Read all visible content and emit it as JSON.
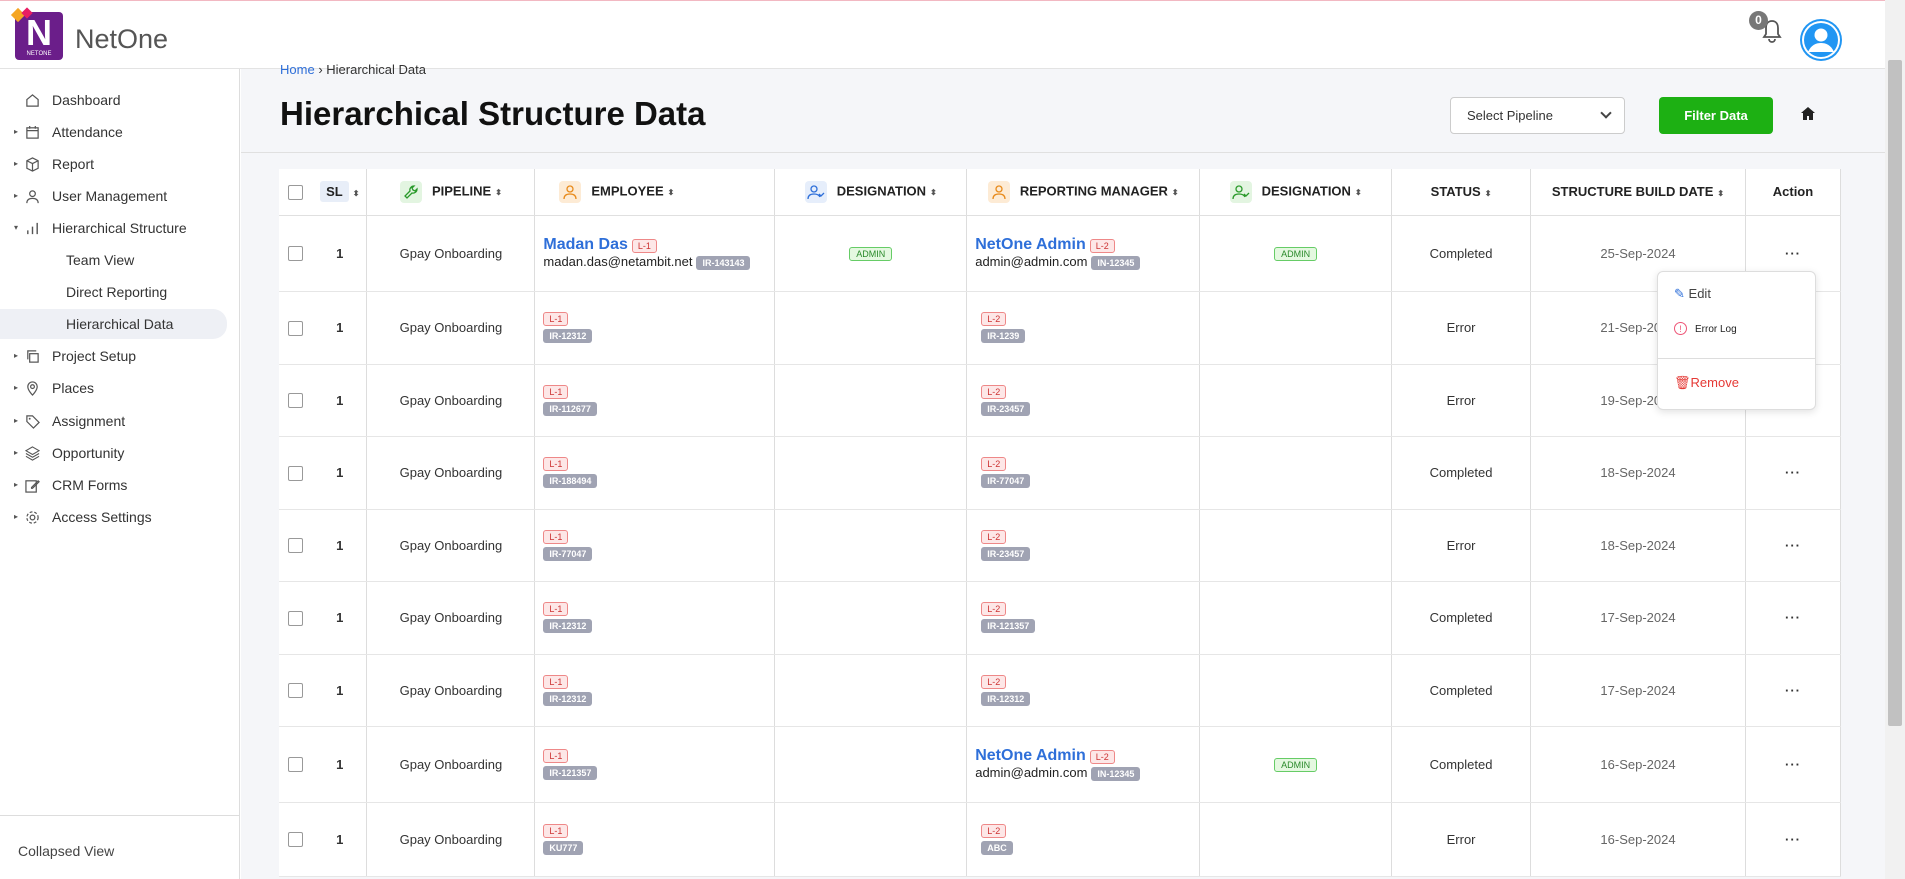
{
  "brand": {
    "name": "NetOne",
    "logo_letter": "N",
    "logo_text": "NETONE"
  },
  "header": {
    "notification_count": "0"
  },
  "sidebar": {
    "items": [
      {
        "label": "Dashboard",
        "icon": "home-icon"
      },
      {
        "label": "Attendance",
        "icon": "calendar-icon"
      },
      {
        "label": "Report",
        "icon": "box-icon"
      },
      {
        "label": "User Management",
        "icon": "user-icon"
      },
      {
        "label": "Hierarchical Structure",
        "icon": "bar-chart-icon"
      },
      {
        "label": "Team View"
      },
      {
        "label": "Direct Reporting"
      },
      {
        "label": "Hierarchical Data"
      },
      {
        "label": "Project Setup",
        "icon": "copy-icon"
      },
      {
        "label": "Places",
        "icon": "map-pin-icon"
      },
      {
        "label": "Assignment",
        "icon": "tag-icon"
      },
      {
        "label": "Opportunity",
        "icon": "layers-icon"
      },
      {
        "label": "CRM Forms",
        "icon": "edit-icon"
      },
      {
        "label": "Access Settings",
        "icon": "gear-icon"
      }
    ],
    "footer": "Collapsed View"
  },
  "breadcrumb": {
    "home": "Home",
    "sep": "›",
    "current": "Hierarchical Data"
  },
  "page": {
    "title": "Hierarchical Structure Data"
  },
  "toolbar": {
    "select_placeholder": "Select Pipeline",
    "filter_label": "Filter Data"
  },
  "table": {
    "headers": {
      "sl": "SL",
      "pipeline": "PIPELINE",
      "employee": "EMPLOYEE",
      "designation": "DESIGNATION",
      "manager": "REPORTING MANAGER",
      "designation2": "DESIGNATION",
      "status": "STATUS",
      "date": "STRUCTURE BUILD DATE",
      "action": "Action"
    },
    "rows": [
      {
        "sl": "1",
        "pipeline": "Gpay Onboarding",
        "emp_name": "Madan Das",
        "emp_level": "L-1",
        "emp_email": "madan.das@netambit.net",
        "emp_id": "IR-143143",
        "emp_desig": "ADMIN",
        "mgr_name": "NetOne Admin",
        "mgr_level": "L-2",
        "mgr_email": "admin@admin.com",
        "mgr_id": "IN-12345",
        "mgr_desig": "ADMIN",
        "status": "Completed",
        "date": "25-Sep-2024",
        "action": "···"
      },
      {
        "sl": "1",
        "pipeline": "Gpay Onboarding",
        "emp_level": "L-1",
        "emp_id": "IR-12312",
        "mgr_level": "L-2",
        "mgr_id": "IR-1239",
        "status": "Error",
        "date": "21-Sep-2024",
        "action": "···"
      },
      {
        "sl": "1",
        "pipeline": "Gpay Onboarding",
        "emp_level": "L-1",
        "emp_id": "IR-112677",
        "mgr_level": "L-2",
        "mgr_id": "IR-23457",
        "status": "Error",
        "date": "19-Sep-2024",
        "action": "···"
      },
      {
        "sl": "1",
        "pipeline": "Gpay Onboarding",
        "emp_level": "L-1",
        "emp_id": "IR-188494",
        "mgr_level": "L-2",
        "mgr_id": "IR-77047",
        "status": "Completed",
        "date": "18-Sep-2024",
        "action": "···"
      },
      {
        "sl": "1",
        "pipeline": "Gpay Onboarding",
        "emp_level": "L-1",
        "emp_id": "IR-77047",
        "mgr_level": "L-2",
        "mgr_id": "IR-23457",
        "status": "Error",
        "date": "18-Sep-2024",
        "action": "···"
      },
      {
        "sl": "1",
        "pipeline": "Gpay Onboarding",
        "emp_level": "L-1",
        "emp_id": "IR-12312",
        "mgr_level": "L-2",
        "mgr_id": "IR-121357",
        "status": "Completed",
        "date": "17-Sep-2024",
        "action": "···"
      },
      {
        "sl": "1",
        "pipeline": "Gpay Onboarding",
        "emp_level": "L-1",
        "emp_id": "IR-12312",
        "mgr_level": "L-2",
        "mgr_id": "IR-12312",
        "status": "Completed",
        "date": "17-Sep-2024",
        "action": "···"
      },
      {
        "sl": "1",
        "pipeline": "Gpay Onboarding",
        "emp_level": "L-1",
        "emp_id": "IR-121357",
        "mgr_name": "NetOne Admin",
        "mgr_level": "L-2",
        "mgr_email": "admin@admin.com",
        "mgr_id": "IN-12345",
        "mgr_desig": "ADMIN",
        "status": "Completed",
        "date": "16-Sep-2024",
        "action": "···"
      },
      {
        "sl": "1",
        "pipeline": "Gpay Onboarding",
        "emp_level": "L-1",
        "emp_id": "KU777",
        "mgr_level": "L-2",
        "mgr_id": "ABC",
        "status": "Error",
        "date": "16-Sep-2024",
        "action": "···"
      }
    ]
  },
  "action_menu": {
    "edit": "Edit",
    "error_log": "Error Log",
    "remove": "Remove"
  },
  "colors": {
    "primary": "#2e6fd9",
    "filter_button": "#1db013",
    "brand": "#6b1e8a",
    "danger": "#e53935"
  }
}
